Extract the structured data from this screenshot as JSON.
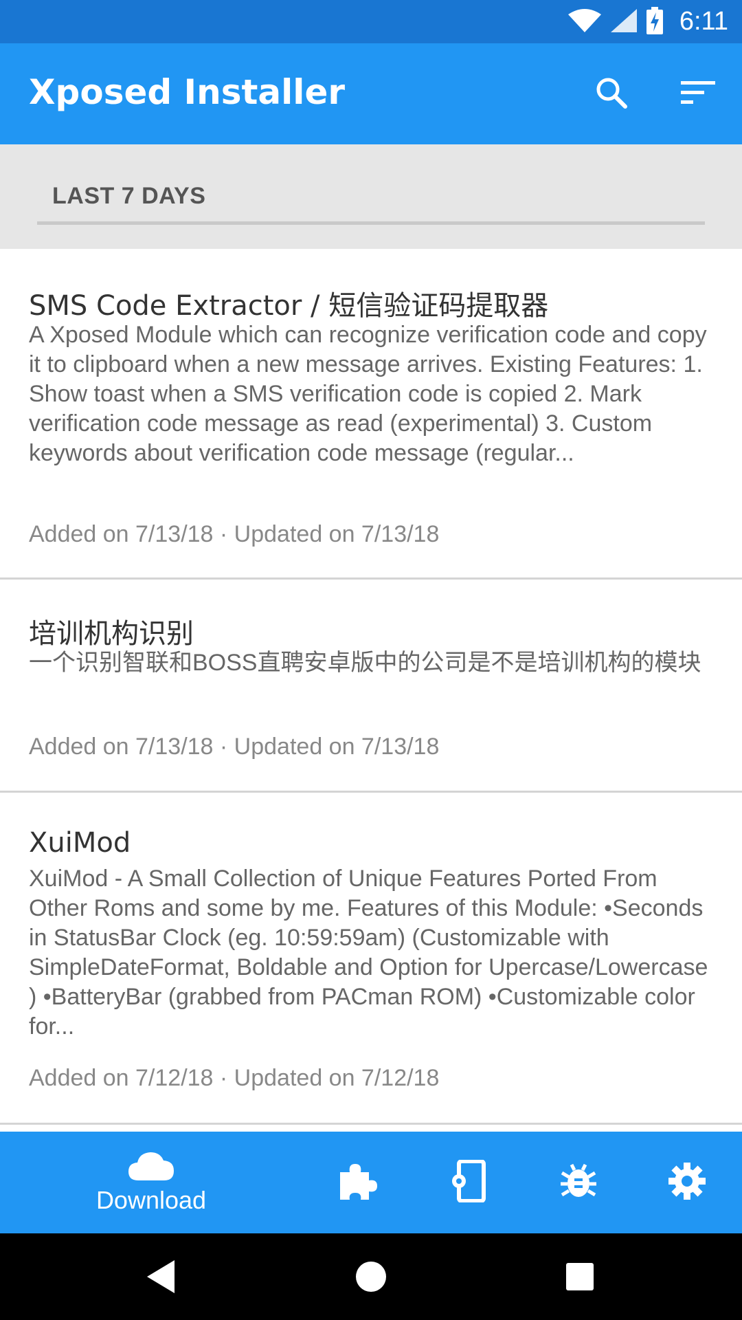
{
  "status_bar": {
    "time": "6:11"
  },
  "app_bar": {
    "title": "Xposed Installer"
  },
  "section": {
    "title": "LAST 7 DAYS"
  },
  "modules": [
    {
      "title": "SMS Code Extractor / 短信验证码提取器",
      "description": "A Xposed Module which can recognize verification code and copy it to clipboard when a new message arrives. Existing Features: 1. Show toast when a SMS verification code is copied 2. Mark verification code message as read (experimental) 3. Custom keywords about verification code message (regular...",
      "meta": "Added on 7/13/18 · Updated on 7/13/18"
    },
    {
      "title": "培训机构识别",
      "description": "一个识别智联和BOSS直聘安卓版中的公司是不是培训机构的模块",
      "meta": "Added on 7/13/18 · Updated on 7/13/18"
    },
    {
      "title": "XuiMod",
      "description": "XuiMod - A Small Collection of Unique Features Ported From Other Roms and some by me. Features of this Module: •Seconds in StatusBar Clock (eg. 10:59:59am) (Customizable with SimpleDateFormat, Boldable and Option for Upercase/Lowercase ) •BatteryBar (grabbed from PACman ROM) •Customizable color for...",
      "meta": "Added on 7/12/18 · Updated on 7/12/18"
    }
  ],
  "bottom_nav": {
    "items": [
      {
        "label": "Download",
        "icon": "cloud-icon",
        "active": true
      },
      {
        "label": "",
        "icon": "puzzle-icon"
      },
      {
        "label": "",
        "icon": "phone-settings-icon"
      },
      {
        "label": "",
        "icon": "bug-icon"
      },
      {
        "label": "",
        "icon": "gear-icon"
      }
    ]
  },
  "colors": {
    "status_bar": "#1976d2",
    "primary": "#2196f3",
    "header_bg": "#e6e6e6"
  }
}
